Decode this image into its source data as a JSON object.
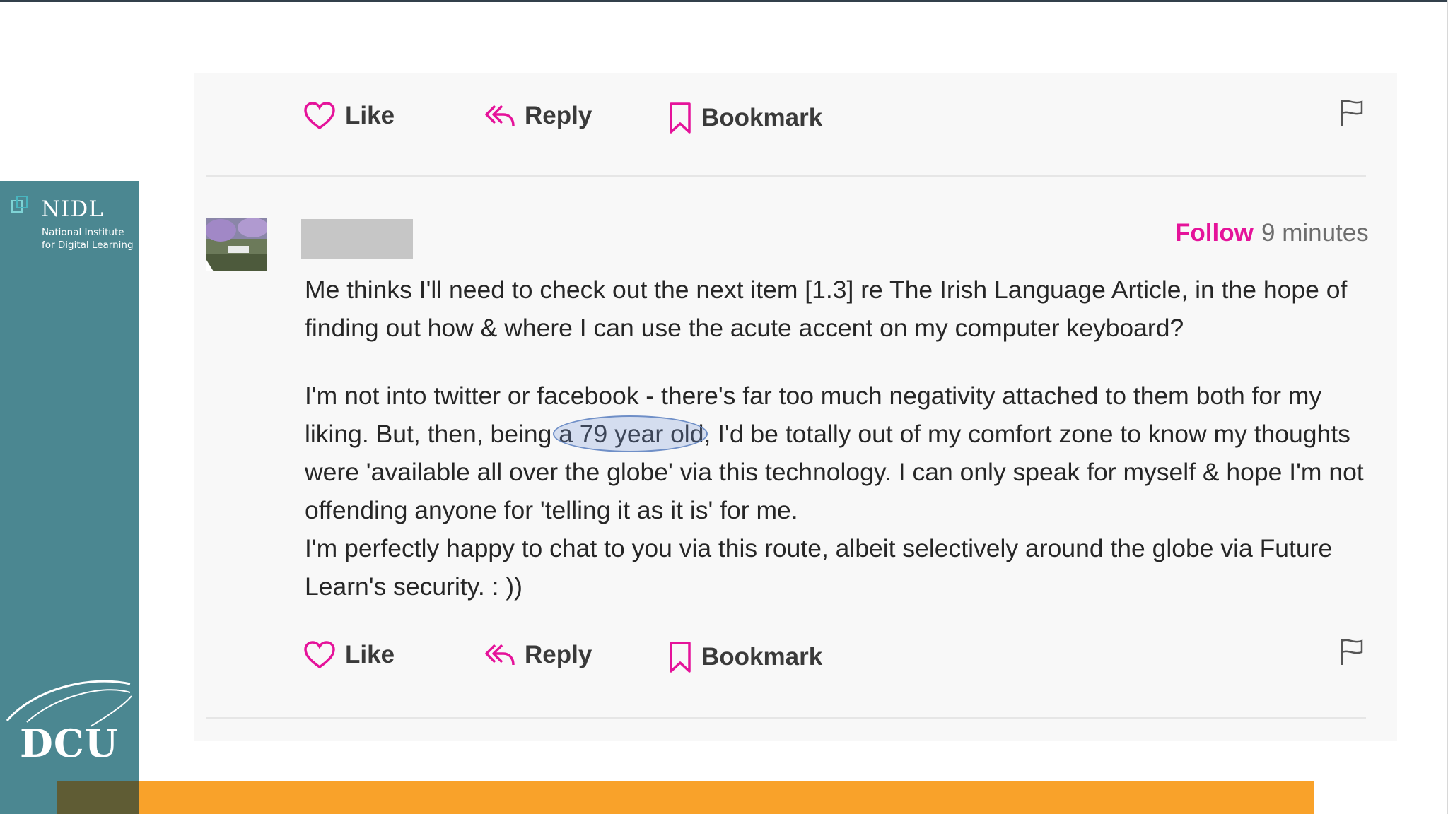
{
  "branding": {
    "nidl_title": "NIDL",
    "nidl_subtitle": "National Institute\nfor Digital Learning",
    "dcu_logo": "DCU"
  },
  "previous_comment": {
    "actions": {
      "like": "Like",
      "reply": "Reply",
      "bookmark": "Bookmark"
    },
    "flag_icon": "flag-icon"
  },
  "comment": {
    "follow_label": "Follow",
    "timestamp": "9 minutes",
    "paragraph1": "Me thinks I'll need to check out the next item [1.3] re The Irish Language Article, in the hope of finding out how & where I can use the acute accent on my computer keyboard?",
    "paragraph2_before": "I'm not into twitter or facebook - there's far too much negativity attached to them both for my liking. But, then, being ",
    "paragraph2_highlight": "a 79 year old",
    "paragraph2_after": ", I'd be totally out of my comfort zone to know my thoughts were 'available all over the globe' via this technology. I can only speak for myself & hope I'm not offending anyone for 'telling it as it is' for me.",
    "paragraph3": "I'm perfectly happy to chat to you via this route, albeit selectively around the globe via Future Learn's security. : ))",
    "actions": {
      "like": "Like",
      "reply": "Reply",
      "bookmark": "Bookmark"
    }
  },
  "colors": {
    "accent_pink": "#e5139a",
    "brand_teal": "#4b8791",
    "footer_orange": "#f9a22a",
    "highlight_blue": "#6f8fc7"
  }
}
